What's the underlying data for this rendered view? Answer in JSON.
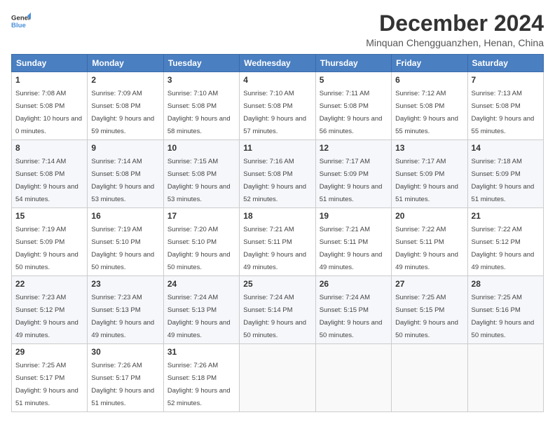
{
  "logo": {
    "general": "General",
    "blue": "Blue"
  },
  "header": {
    "month_year": "December 2024",
    "location": "Minquan Chengguanzhen, Henan, China"
  },
  "weekdays": [
    "Sunday",
    "Monday",
    "Tuesday",
    "Wednesday",
    "Thursday",
    "Friday",
    "Saturday"
  ],
  "weeks": [
    [
      {
        "day": 1,
        "sunrise": "7:08 AM",
        "sunset": "5:08 PM",
        "daylight": "10 hours and 0 minutes."
      },
      {
        "day": 2,
        "sunrise": "7:09 AM",
        "sunset": "5:08 PM",
        "daylight": "9 hours and 59 minutes."
      },
      {
        "day": 3,
        "sunrise": "7:10 AM",
        "sunset": "5:08 PM",
        "daylight": "9 hours and 58 minutes."
      },
      {
        "day": 4,
        "sunrise": "7:10 AM",
        "sunset": "5:08 PM",
        "daylight": "9 hours and 57 minutes."
      },
      {
        "day": 5,
        "sunrise": "7:11 AM",
        "sunset": "5:08 PM",
        "daylight": "9 hours and 56 minutes."
      },
      {
        "day": 6,
        "sunrise": "7:12 AM",
        "sunset": "5:08 PM",
        "daylight": "9 hours and 55 minutes."
      },
      {
        "day": 7,
        "sunrise": "7:13 AM",
        "sunset": "5:08 PM",
        "daylight": "9 hours and 55 minutes."
      }
    ],
    [
      {
        "day": 8,
        "sunrise": "7:14 AM",
        "sunset": "5:08 PM",
        "daylight": "9 hours and 54 minutes."
      },
      {
        "day": 9,
        "sunrise": "7:14 AM",
        "sunset": "5:08 PM",
        "daylight": "9 hours and 53 minutes."
      },
      {
        "day": 10,
        "sunrise": "7:15 AM",
        "sunset": "5:08 PM",
        "daylight": "9 hours and 53 minutes."
      },
      {
        "day": 11,
        "sunrise": "7:16 AM",
        "sunset": "5:08 PM",
        "daylight": "9 hours and 52 minutes."
      },
      {
        "day": 12,
        "sunrise": "7:17 AM",
        "sunset": "5:09 PM",
        "daylight": "9 hours and 51 minutes."
      },
      {
        "day": 13,
        "sunrise": "7:17 AM",
        "sunset": "5:09 PM",
        "daylight": "9 hours and 51 minutes."
      },
      {
        "day": 14,
        "sunrise": "7:18 AM",
        "sunset": "5:09 PM",
        "daylight": "9 hours and 51 minutes."
      }
    ],
    [
      {
        "day": 15,
        "sunrise": "7:19 AM",
        "sunset": "5:09 PM",
        "daylight": "9 hours and 50 minutes."
      },
      {
        "day": 16,
        "sunrise": "7:19 AM",
        "sunset": "5:10 PM",
        "daylight": "9 hours and 50 minutes."
      },
      {
        "day": 17,
        "sunrise": "7:20 AM",
        "sunset": "5:10 PM",
        "daylight": "9 hours and 50 minutes."
      },
      {
        "day": 18,
        "sunrise": "7:21 AM",
        "sunset": "5:11 PM",
        "daylight": "9 hours and 49 minutes."
      },
      {
        "day": 19,
        "sunrise": "7:21 AM",
        "sunset": "5:11 PM",
        "daylight": "9 hours and 49 minutes."
      },
      {
        "day": 20,
        "sunrise": "7:22 AM",
        "sunset": "5:11 PM",
        "daylight": "9 hours and 49 minutes."
      },
      {
        "day": 21,
        "sunrise": "7:22 AM",
        "sunset": "5:12 PM",
        "daylight": "9 hours and 49 minutes."
      }
    ],
    [
      {
        "day": 22,
        "sunrise": "7:23 AM",
        "sunset": "5:12 PM",
        "daylight": "9 hours and 49 minutes."
      },
      {
        "day": 23,
        "sunrise": "7:23 AM",
        "sunset": "5:13 PM",
        "daylight": "9 hours and 49 minutes."
      },
      {
        "day": 24,
        "sunrise": "7:24 AM",
        "sunset": "5:13 PM",
        "daylight": "9 hours and 49 minutes."
      },
      {
        "day": 25,
        "sunrise": "7:24 AM",
        "sunset": "5:14 PM",
        "daylight": "9 hours and 50 minutes."
      },
      {
        "day": 26,
        "sunrise": "7:24 AM",
        "sunset": "5:15 PM",
        "daylight": "9 hours and 50 minutes."
      },
      {
        "day": 27,
        "sunrise": "7:25 AM",
        "sunset": "5:15 PM",
        "daylight": "9 hours and 50 minutes."
      },
      {
        "day": 28,
        "sunrise": "7:25 AM",
        "sunset": "5:16 PM",
        "daylight": "9 hours and 50 minutes."
      }
    ],
    [
      {
        "day": 29,
        "sunrise": "7:25 AM",
        "sunset": "5:17 PM",
        "daylight": "9 hours and 51 minutes."
      },
      {
        "day": 30,
        "sunrise": "7:26 AM",
        "sunset": "5:17 PM",
        "daylight": "9 hours and 51 minutes."
      },
      {
        "day": 31,
        "sunrise": "7:26 AM",
        "sunset": "5:18 PM",
        "daylight": "9 hours and 52 minutes."
      },
      null,
      null,
      null,
      null
    ]
  ],
  "labels": {
    "sunrise": "Sunrise:",
    "sunset": "Sunset:",
    "daylight": "Daylight:"
  }
}
